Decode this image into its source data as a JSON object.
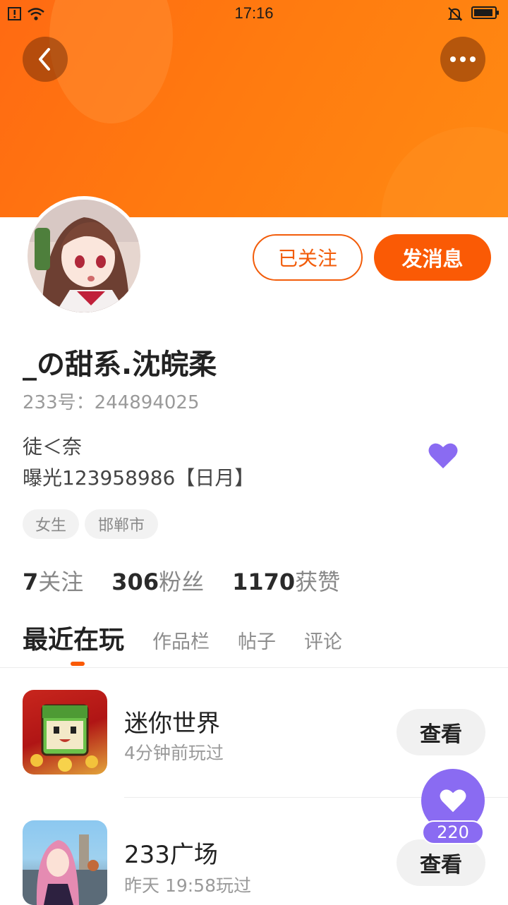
{
  "status_bar": {
    "time": "17:16"
  },
  "profile": {
    "username": "_の甜系.沈皖柔",
    "uid": "233号：244894025",
    "bio_line1": "徒＜奈",
    "bio_line2": "曝光123958986【日月】",
    "tags": [
      "女生",
      "邯郸市"
    ],
    "followed_label": "已关注",
    "message_label": "发消息"
  },
  "stats": [
    {
      "num": "7",
      "label": "关注"
    },
    {
      "num": "306",
      "label": "粉丝"
    },
    {
      "num": "1170",
      "label": "获赞"
    }
  ],
  "tabs": [
    {
      "label": "最近在玩",
      "active": true
    },
    {
      "label": "作品栏"
    },
    {
      "label": "帖子"
    },
    {
      "label": "评论"
    }
  ],
  "games": [
    {
      "name": "迷你世界",
      "subtitle": "4分钟前玩过",
      "button": "查看",
      "icon": "mini-world-game-icon"
    },
    {
      "name": "233广场",
      "subtitle": "昨天 19:58玩过",
      "button": "查看",
      "icon": "233-plaza-game-icon"
    }
  ],
  "floating_like": {
    "count": "220"
  },
  "colors": {
    "brand_orange": "#fa5a05",
    "like_purple": "#8a6bf2"
  }
}
